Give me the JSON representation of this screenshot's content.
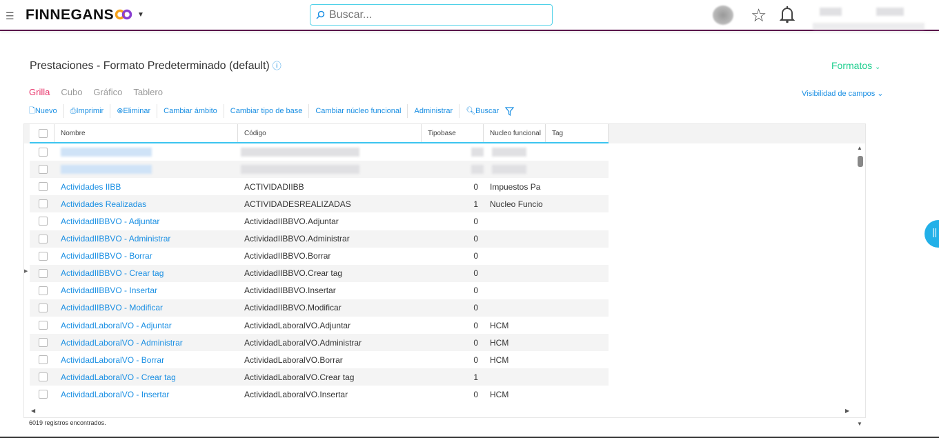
{
  "header": {
    "brand": "FINNEGANS",
    "search_placeholder": "Buscar..."
  },
  "page": {
    "title": "Prestaciones - Formato Predeterminado (default)",
    "formatos": "Formatos",
    "visibilidad": "Visibilidad de campos"
  },
  "tabs": [
    "Grilla",
    "Cubo",
    "Gráfico",
    "Tablero"
  ],
  "toolbar": {
    "nuevo": "Nuevo",
    "imprimir": "Imprimir",
    "eliminar": "Eliminar",
    "ambito": "Cambiar ámbito",
    "tipo_base": "Cambiar tipo de base",
    "nucleo": "Cambiar núcleo funcional",
    "administrar": "Administrar",
    "buscar": "Buscar"
  },
  "columns": [
    "Nombre",
    "Código",
    "Tipobase",
    "Nucleo funcional",
    "Tag"
  ],
  "rows": [
    {
      "nombre": "",
      "codigo": "",
      "tipobase": "",
      "nucleo": ""
    },
    {
      "nombre": "",
      "codigo": "",
      "tipobase": "",
      "nucleo": ""
    },
    {
      "nombre": "Actividades IIBB",
      "codigo": "ACTIVIDADIIBB",
      "tipobase": "0",
      "nucleo": "Impuestos Pa"
    },
    {
      "nombre": "Actividades Realizadas",
      "codigo": "ACTIVIDADESREALIZADAS",
      "tipobase": "1",
      "nucleo": "Nucleo Funcio"
    },
    {
      "nombre": "ActividadIIBBVO - Adjuntar",
      "codigo": "ActividadIIBBVO.Adjuntar",
      "tipobase": "0",
      "nucleo": ""
    },
    {
      "nombre": "ActividadIIBBVO - Administrar",
      "codigo": "ActividadIIBBVO.Administrar",
      "tipobase": "0",
      "nucleo": ""
    },
    {
      "nombre": "ActividadIIBBVO - Borrar",
      "codigo": "ActividadIIBBVO.Borrar",
      "tipobase": "0",
      "nucleo": ""
    },
    {
      "nombre": "ActividadIIBBVO - Crear tag",
      "codigo": "ActividadIIBBVO.Crear tag",
      "tipobase": "0",
      "nucleo": ""
    },
    {
      "nombre": "ActividadIIBBVO - Insertar",
      "codigo": "ActividadIIBBVO.Insertar",
      "tipobase": "0",
      "nucleo": ""
    },
    {
      "nombre": "ActividadIIBBVO - Modificar",
      "codigo": "ActividadIIBBVO.Modificar",
      "tipobase": "0",
      "nucleo": ""
    },
    {
      "nombre": "ActividadLaboralVO - Adjuntar",
      "codigo": "ActividadLaboralVO.Adjuntar",
      "tipobase": "0",
      "nucleo": "HCM"
    },
    {
      "nombre": "ActividadLaboralVO - Administrar",
      "codigo": "ActividadLaboralVO.Administrar",
      "tipobase": "0",
      "nucleo": "HCM"
    },
    {
      "nombre": "ActividadLaboralVO - Borrar",
      "codigo": "ActividadLaboralVO.Borrar",
      "tipobase": "0",
      "nucleo": "HCM"
    },
    {
      "nombre": "ActividadLaboralVO - Crear tag",
      "codigo": "ActividadLaboralVO.Crear tag",
      "tipobase": "1",
      "nucleo": ""
    },
    {
      "nombre": "ActividadLaboralVO - Insertar",
      "codigo": "ActividadLaboralVO.Insertar",
      "tipobase": "0",
      "nucleo": "HCM"
    }
  ],
  "footer": "6019 registros encontrados.",
  "colors": {
    "accent": "#1a8fe3",
    "tab_active": "#e8336a",
    "formatos": "#1fcf8f",
    "topbar_border": "#5a0a4a"
  }
}
